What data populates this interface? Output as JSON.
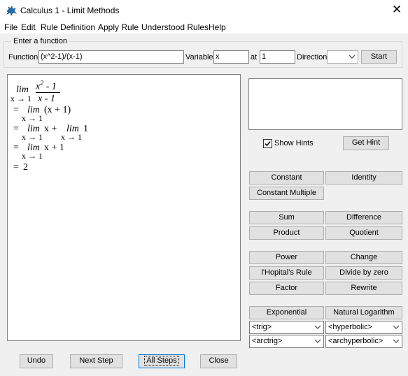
{
  "window": {
    "title": "Calculus 1 - Limit Methods",
    "close_glyph": "✕",
    "icon": "app-icon"
  },
  "menu": [
    "File",
    "Edit",
    "Rule Definition",
    "Apply Rule",
    "Understood Rules",
    "Help"
  ],
  "input_group": {
    "title": "Enter a function",
    "function_label": "Function",
    "function_value": "(x^2-1)/(x-1)",
    "variable_label": "Variable",
    "variable_value": "x",
    "at_label": "at",
    "at_value": "1",
    "direction_label": "Direction",
    "direction_value": "",
    "start_label": "Start"
  },
  "math": {
    "lim": "lim",
    "sub": "x → 1",
    "numerator": "x",
    "numerator_exp": "2",
    "numerator_rest": " - 1",
    "denominator": "x - 1",
    "eq": "=",
    "step1": "(x + 1)",
    "step2_a": "x +",
    "step2_b": "1",
    "step3": "x + 1",
    "result": "2"
  },
  "hints": {
    "show_hints_label": "Show Hints",
    "show_hints_checked": true,
    "get_hint_label": "Get Hint"
  },
  "rules": {
    "constant": "Constant",
    "identity": "Identity",
    "constant_multiple": "Constant Multiple",
    "sum": "Sum",
    "difference": "Difference",
    "product": "Product",
    "quotient": "Quotient",
    "power": "Power",
    "change": "Change",
    "lhopital": "l'Hopital's Rule",
    "divide_by_zero": "Divide by zero",
    "factor": "Factor",
    "rewrite": "Rewrite",
    "exponential": "Exponential",
    "natural_log": "Natural Logarithm"
  },
  "selects": {
    "trig": "<trig>",
    "hyperbolic": "<hyperbolic>",
    "arctrig": "<arctrig>",
    "archyperbolic": "<archyperbolic>"
  },
  "bottom": {
    "undo": "Undo",
    "next_step": "Next Step",
    "all_steps": "All Steps",
    "close": "Close"
  },
  "colors": {
    "accent_border": "#0078d7",
    "window_bg": "#f0f0f0"
  }
}
